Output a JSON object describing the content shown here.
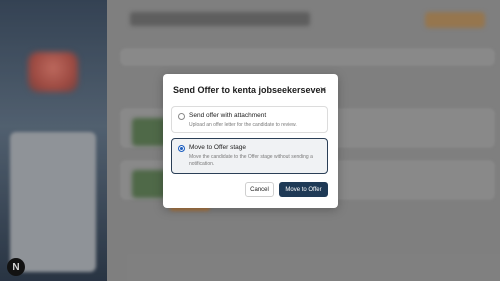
{
  "dialog": {
    "title": "Send Offer to kenta jobseekerseven",
    "options": [
      {
        "label": "Send offer with attachment",
        "description": "Upload an offer letter for the candidate to review.",
        "selected": false
      },
      {
        "label": "Move to Offer stage",
        "description": "Move the candidate to the Offer stage without sending a notification.",
        "selected": true
      }
    ],
    "cancel_label": "Cancel",
    "confirm_label": "Move to Offer"
  },
  "badge": {
    "label": "N"
  },
  "icons": {
    "close": "close-icon"
  },
  "colors": {
    "primary": "#1f3a56",
    "radio_selected": "#1e5fbf"
  }
}
